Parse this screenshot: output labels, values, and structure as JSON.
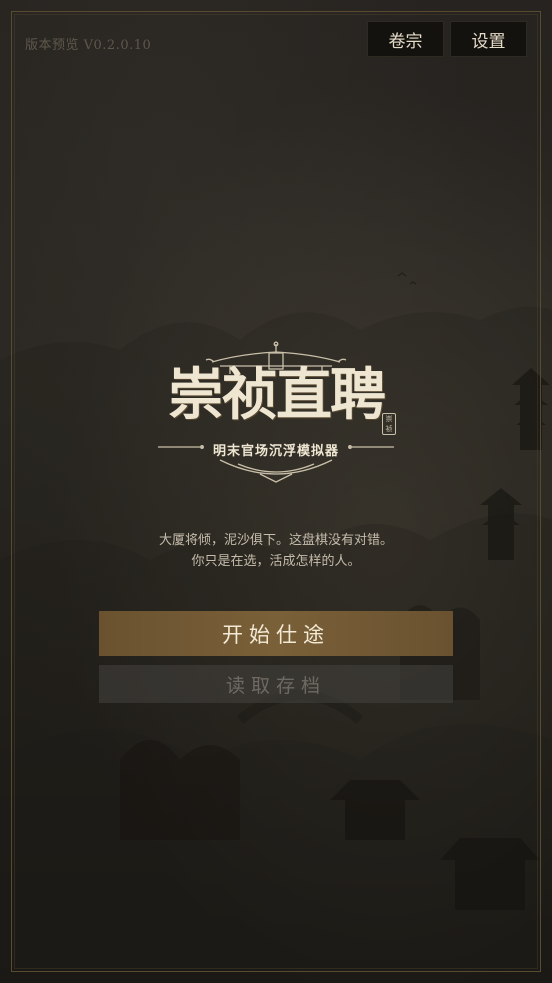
{
  "header": {
    "version": "版本预览 V0.2.0.10",
    "archive_label": "卷宗",
    "settings_label": "设置"
  },
  "logo": {
    "title": "崇祯直聘",
    "subtitle": "明末官场沉浮模拟器",
    "seal": "崇祯"
  },
  "tagline": {
    "line1": "大厦将倾，泥沙俱下。这盘棋没有对错。",
    "line2": "你只是在选，活成怎样的人。"
  },
  "menu": {
    "start_label": "开始仕途",
    "load_label": "读取存档"
  },
  "colors": {
    "accent_gold": "#7a6038",
    "background": "#262320",
    "text_light": "#efe6d2"
  }
}
